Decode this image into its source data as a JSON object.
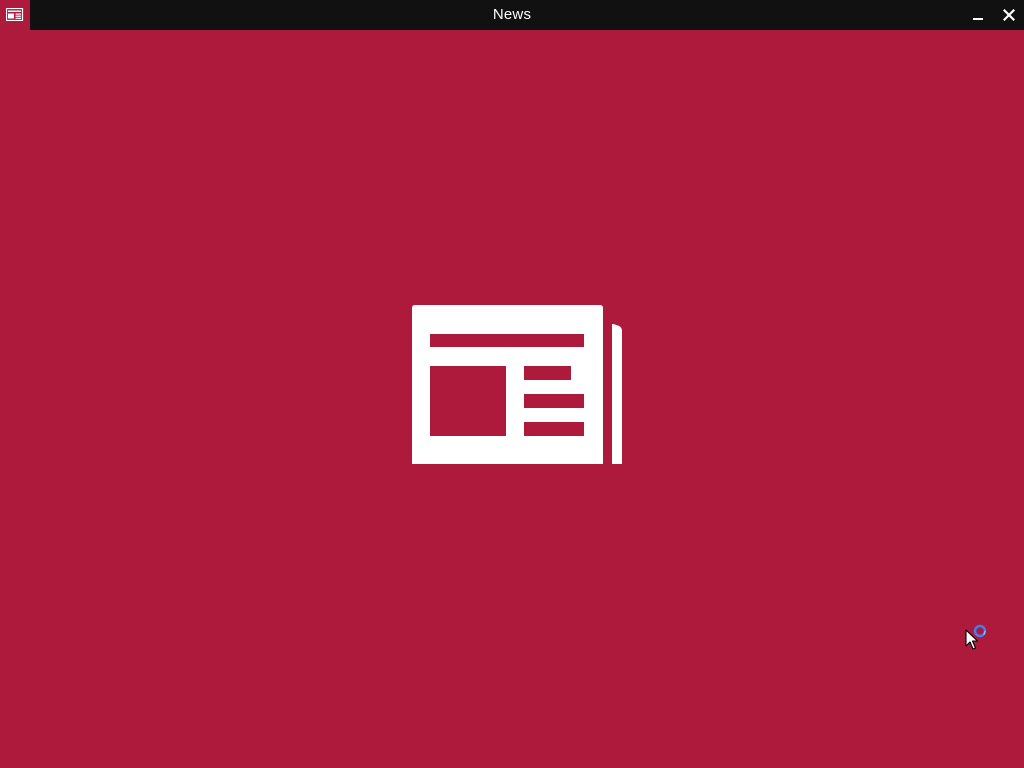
{
  "window": {
    "title": "News",
    "app_icon": "news-app-icon",
    "controls": {
      "minimize_icon": "minimize-icon",
      "close_icon": "close-icon"
    }
  },
  "splash": {
    "logo": "newspaper-icon",
    "background_color": "#ad1a3c",
    "foreground_color": "#ffffff"
  },
  "cursor": {
    "state": "busy",
    "icon": "busy-pointer-icon"
  }
}
